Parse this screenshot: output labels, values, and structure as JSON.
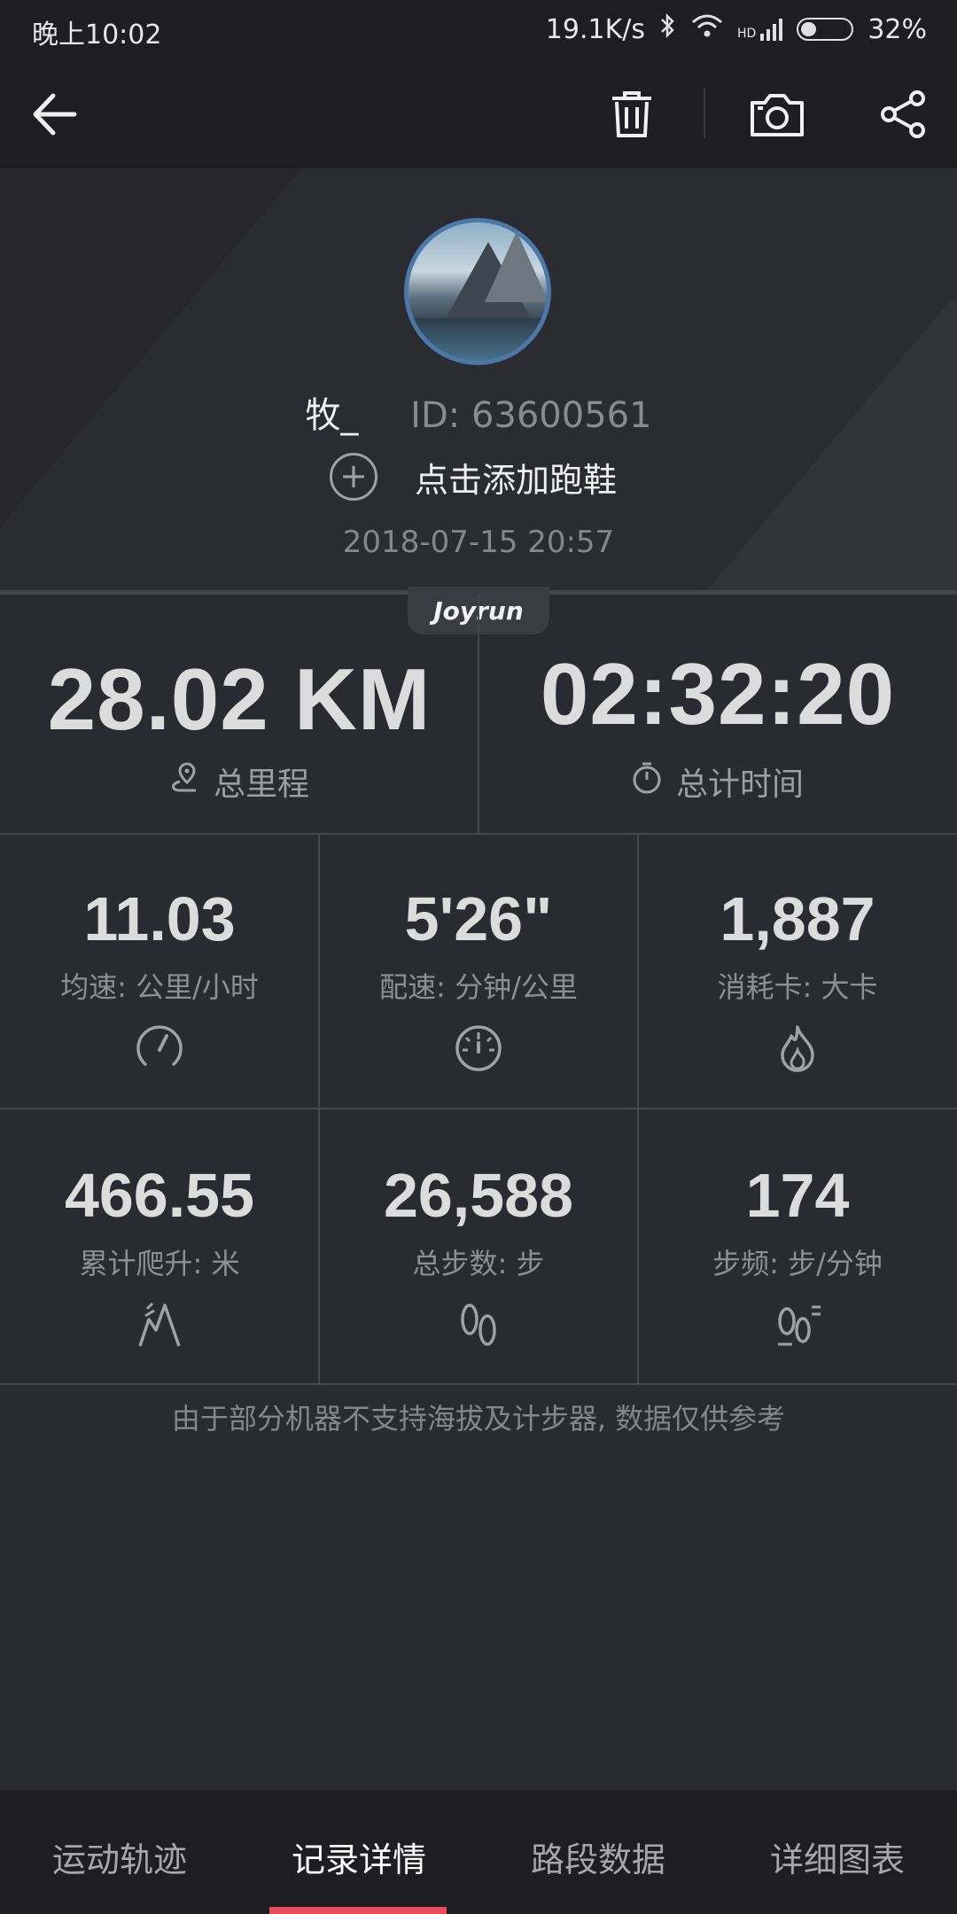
{
  "status_bar": {
    "time": "晚上10:02",
    "network_speed": "19.1K/s",
    "signal_label": "HD",
    "battery_percent": "32%",
    "battery_level": 0.32
  },
  "toolbar": {
    "back_icon": "arrow-left-icon",
    "delete_icon": "trash-icon",
    "camera_icon": "camera-icon",
    "share_icon": "share-icon"
  },
  "profile": {
    "name": "牧_",
    "user_id": "ID: 63600561",
    "add_shoe_label": "点击添加跑鞋",
    "datetime": "2018-07-15 20:57"
  },
  "brand_badge": "Joyrun",
  "summary": {
    "distance_value": "28.02 KM",
    "distance_label": "总里程",
    "duration_value": "02:32:20",
    "duration_label": "总计时间"
  },
  "stats": [
    {
      "value": "11.03",
      "label": "均速: 公里/小时",
      "icon": "speedometer-icon"
    },
    {
      "value": "5'26\"",
      "label": "配速: 分钟/公里",
      "icon": "stopwatch-icon"
    },
    {
      "value": "1,887",
      "label": "消耗卡: 大卡",
      "icon": "flame-icon"
    },
    {
      "value": "466.55",
      "label": "累计爬升: 米",
      "icon": "climb-icon"
    },
    {
      "value": "26,588",
      "label": "总步数: 步",
      "icon": "footprints-icon"
    },
    {
      "value": "174",
      "label": "步频: 步/分钟",
      "icon": "cadence-icon"
    }
  ],
  "disclaimer": "由于部分机器不支持海拔及计步器, 数据仅供参考",
  "tabs": [
    {
      "label": "运动轨迹",
      "active": false
    },
    {
      "label": "记录详情",
      "active": true
    },
    {
      "label": "路段数据",
      "active": false
    },
    {
      "label": "详细图表",
      "active": false
    }
  ],
  "colors": {
    "background": "#2a2a31",
    "bar_background": "#1d1d22",
    "accent": "#e94c5a",
    "avatar_border": "#4b78a8"
  }
}
